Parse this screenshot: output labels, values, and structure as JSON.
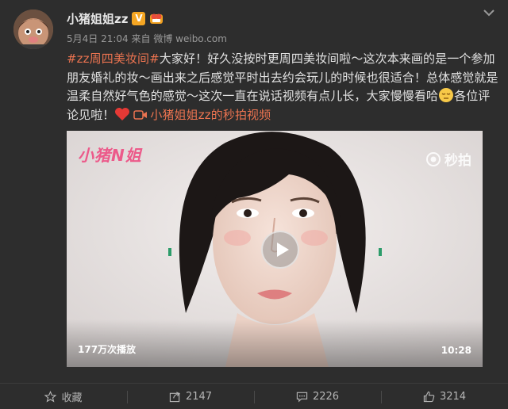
{
  "user": {
    "name": "小猪姐姐zz",
    "verified_badge": "V",
    "timestamp": "5月4日 21:04",
    "source_prefix": "来自",
    "source": "微博 weibo.com"
  },
  "post": {
    "hashtag": "#zz周四美妆间#",
    "text_1": "大家好！好久没按时更周四美妆间啦～这次本来画的是一个参加朋友婚礼的妆～画出来之后感觉平时出去约会玩儿的时候也很适合！总体感觉就是温柔自然好气色的感觉～这次一直在说话视频有点儿长，大家慢慢看哈",
    "text_2": "各位评论见啦！",
    "video_link": "小猪姐姐zz的秒拍视频"
  },
  "video": {
    "watermark_left": "小猪N姐",
    "watermark_right": "秒拍",
    "plays": "177万次播放",
    "duration": "10:28"
  },
  "footer": {
    "favorite_label": "收藏",
    "repost_count": "2147",
    "comment_count": "2226",
    "like_count": "3214"
  },
  "icons": {
    "more": "chevron-down-icon",
    "favorite": "star-icon",
    "repost": "share-icon",
    "comment": "comment-icon",
    "like": "thumbs-up-icon",
    "play": "play-icon"
  },
  "colors": {
    "link": "#eb7350",
    "background": "#2d2d2d",
    "verified": "#f5a623"
  }
}
